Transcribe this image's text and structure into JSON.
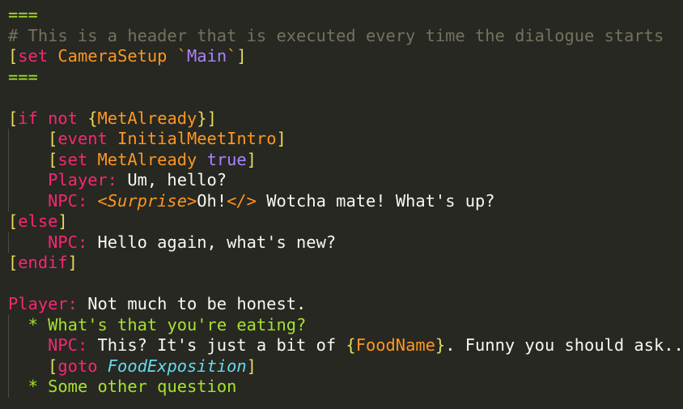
{
  "editor": {
    "theme_name": "monokai",
    "background_color": "#272822",
    "default_text_color": "#F8F8F2",
    "indent_guide_color": "#4b4c45",
    "colors": {
      "separator": "#A6E22E",
      "comment": "#75715E",
      "bracket": "#E6DB5A",
      "keyword": "#F92672",
      "identifier": "#FD971F",
      "brace": "#E6DB5A",
      "value": "#AE81FF",
      "quote": "#FD971F",
      "speaker": "#F92672",
      "dialogue_text": "#F8F8F2",
      "tag": "#FD971F",
      "choice": "#A6E22E",
      "goto_target": "#66D9EF"
    }
  },
  "lines": [
    {
      "id": 1,
      "guide": false,
      "tokens": [
        {
          "text": "===",
          "type": "sep"
        }
      ]
    },
    {
      "id": 2,
      "guide": false,
      "tokens": [
        {
          "text": "# This is a header that is executed every time the dialogue starts",
          "type": "comment"
        }
      ]
    },
    {
      "id": 3,
      "guide": false,
      "tokens": [
        {
          "text": "[",
          "type": "bracket"
        },
        {
          "text": "set",
          "type": "keyword"
        },
        {
          "text": " ",
          "type": "text"
        },
        {
          "text": "CameraSetup",
          "type": "ident"
        },
        {
          "text": " ",
          "type": "text"
        },
        {
          "text": "`",
          "type": "quote"
        },
        {
          "text": "Main",
          "type": "value"
        },
        {
          "text": "`",
          "type": "quote"
        },
        {
          "text": "]",
          "type": "bracket"
        }
      ]
    },
    {
      "id": 4,
      "guide": false,
      "tokens": [
        {
          "text": "===",
          "type": "sep"
        }
      ]
    },
    {
      "id": 5,
      "guide": false,
      "tokens": []
    },
    {
      "id": 6,
      "guide": false,
      "tokens": [
        {
          "text": "[",
          "type": "bracket"
        },
        {
          "text": "if",
          "type": "keyword"
        },
        {
          "text": " ",
          "type": "text"
        },
        {
          "text": "not",
          "type": "keyword"
        },
        {
          "text": " ",
          "type": "text"
        },
        {
          "text": "{",
          "type": "brace"
        },
        {
          "text": "MetAlready",
          "type": "ident"
        },
        {
          "text": "}",
          "type": "brace"
        },
        {
          "text": "]",
          "type": "bracket"
        }
      ]
    },
    {
      "id": 7,
      "guide": true,
      "tokens": [
        {
          "text": "    ",
          "type": "text"
        },
        {
          "text": "[",
          "type": "bracket"
        },
        {
          "text": "event",
          "type": "keyword"
        },
        {
          "text": " ",
          "type": "text"
        },
        {
          "text": "InitialMeetIntro",
          "type": "ident"
        },
        {
          "text": "]",
          "type": "bracket"
        }
      ]
    },
    {
      "id": 8,
      "guide": true,
      "tokens": [
        {
          "text": "    ",
          "type": "text"
        },
        {
          "text": "[",
          "type": "bracket"
        },
        {
          "text": "set",
          "type": "keyword"
        },
        {
          "text": " ",
          "type": "text"
        },
        {
          "text": "MetAlready",
          "type": "ident"
        },
        {
          "text": " ",
          "type": "text"
        },
        {
          "text": "true",
          "type": "value"
        },
        {
          "text": "]",
          "type": "bracket"
        }
      ]
    },
    {
      "id": 9,
      "guide": true,
      "tokens": [
        {
          "text": "    ",
          "type": "text"
        },
        {
          "text": "Player:",
          "type": "speaker"
        },
        {
          "text": " Um, hello?",
          "type": "text"
        }
      ]
    },
    {
      "id": 10,
      "guide": true,
      "tokens": [
        {
          "text": "    ",
          "type": "text"
        },
        {
          "text": "NPC:",
          "type": "speaker"
        },
        {
          "text": " ",
          "type": "text"
        },
        {
          "text": "<Surprise>",
          "type": "tag"
        },
        {
          "text": "Oh!",
          "type": "text"
        },
        {
          "text": "</>",
          "type": "tag"
        },
        {
          "text": " Wotcha mate! What's up?",
          "type": "text"
        }
      ]
    },
    {
      "id": 11,
      "guide": false,
      "tokens": [
        {
          "text": "[",
          "type": "bracket"
        },
        {
          "text": "else",
          "type": "keyword"
        },
        {
          "text": "]",
          "type": "bracket"
        }
      ]
    },
    {
      "id": 12,
      "guide": true,
      "tokens": [
        {
          "text": "    ",
          "type": "text"
        },
        {
          "text": "NPC:",
          "type": "speaker"
        },
        {
          "text": " Hello again, what's new?",
          "type": "text"
        }
      ]
    },
    {
      "id": 13,
      "guide": false,
      "tokens": [
        {
          "text": "[",
          "type": "bracket"
        },
        {
          "text": "endif",
          "type": "keyword"
        },
        {
          "text": "]",
          "type": "bracket"
        }
      ]
    },
    {
      "id": 14,
      "guide": false,
      "tokens": []
    },
    {
      "id": 15,
      "guide": false,
      "tokens": [
        {
          "text": "Player:",
          "type": "speaker"
        },
        {
          "text": " Not much to be honest.",
          "type": "text"
        }
      ]
    },
    {
      "id": 16,
      "guide": true,
      "tokens": [
        {
          "text": "  ",
          "type": "text"
        },
        {
          "text": "*",
          "type": "bullet"
        },
        {
          "text": " ",
          "type": "text"
        },
        {
          "text": "What's that you're eating?",
          "type": "choice"
        }
      ]
    },
    {
      "id": 17,
      "guide": true,
      "tokens": [
        {
          "text": "    ",
          "type": "text"
        },
        {
          "text": "NPC:",
          "type": "speaker"
        },
        {
          "text": " This? It's just a bit of ",
          "type": "text"
        },
        {
          "text": "{",
          "type": "brace"
        },
        {
          "text": "FoodName",
          "type": "ident"
        },
        {
          "text": "}",
          "type": "brace"
        },
        {
          "text": ". Funny you should ask...",
          "type": "text"
        }
      ]
    },
    {
      "id": 18,
      "guide": true,
      "tokens": [
        {
          "text": "    ",
          "type": "text"
        },
        {
          "text": "[",
          "type": "bracket"
        },
        {
          "text": "goto",
          "type": "keyword"
        },
        {
          "text": " ",
          "type": "text"
        },
        {
          "text": "FoodExposition",
          "type": "target"
        },
        {
          "text": "]",
          "type": "bracket"
        }
      ]
    },
    {
      "id": 19,
      "guide": true,
      "tokens": [
        {
          "text": "  ",
          "type": "text"
        },
        {
          "text": "*",
          "type": "bullet"
        },
        {
          "text": " ",
          "type": "text"
        },
        {
          "text": "Some other question",
          "type": "choice"
        }
      ]
    }
  ]
}
